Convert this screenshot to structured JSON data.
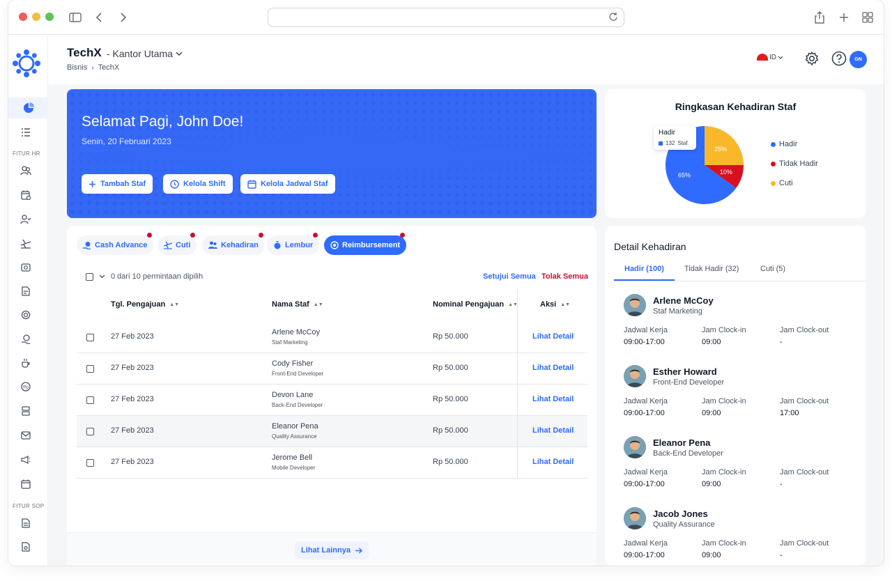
{
  "app": {
    "title": "TechX",
    "subtitle": "- Kantor Utama",
    "breadcrumb": [
      "Bisnis",
      "TechX"
    ],
    "language": "ID",
    "avatar_initials": "GN"
  },
  "sidebar": {
    "section_hr": "FITUR HR",
    "section_sop": "FITUR SOP"
  },
  "hero": {
    "greeting": "Selamat Pagi, John Doe!",
    "date": "Senin, 20 Februari 2023",
    "buttons": [
      {
        "label": "Tambah Staf",
        "icon": "plus-icon"
      },
      {
        "label": "Kelola Shift",
        "icon": "clock-icon"
      },
      {
        "label": "Kelola Jadwal Staf",
        "icon": "calendar-icon"
      }
    ]
  },
  "attendance_summary": {
    "title": "Ringkasan Kehadiran Staf",
    "tooltip": {
      "label": "Hadir",
      "value": "132",
      "unit": "Staf"
    },
    "chart_data": {
      "type": "pie",
      "slices": [
        {
          "name": "Hadir",
          "value": 65,
          "label": "65%",
          "color": "#2f6bff"
        },
        {
          "name": "Tidak Hadir",
          "value": 10,
          "label": "10%",
          "color": "#d90f1f"
        },
        {
          "name": "Cuti",
          "value": 25,
          "label": "25%",
          "color": "#f9b82c"
        }
      ],
      "legend": [
        "Hadir",
        "Tidak Hadir",
        "Cuti"
      ],
      "legend_position": "right"
    }
  },
  "requests": {
    "tabs": [
      {
        "label": "Cash Advance",
        "icon": "cash-advance-icon",
        "active": false
      },
      {
        "label": "Cuti",
        "icon": "plane-icon",
        "active": false
      },
      {
        "label": "Kehadiran",
        "icon": "users-icon",
        "active": false
      },
      {
        "label": "Lembur",
        "icon": "overtime-icon",
        "active": false
      },
      {
        "label": "Reimbursement",
        "icon": "reimbursement-icon",
        "active": true
      }
    ],
    "selection_text": "0 dari 10 permintaan dipilih",
    "approve_all": "Setujui Semua",
    "reject_all": "Tolak Semua",
    "columns": [
      "Tgl. Pengajuan",
      "Nama Staf",
      "Nominal Pengajuan",
      "Aksi"
    ],
    "rows": [
      {
        "date": "27 Feb 2023",
        "name": "Arlene McCoy",
        "role": "Staf Marketing",
        "amount": "Rp 50.000",
        "action": "Lihat Detail"
      },
      {
        "date": "27 Feb 2023",
        "name": "Cody Fisher",
        "role": "Front-End Developer",
        "amount": "Rp 50.000",
        "action": "Lihat Detail"
      },
      {
        "date": "27 Feb 2023",
        "name": "Devon Lane",
        "role": "Back-End Developer",
        "amount": "Rp 50.000",
        "action": "Lihat Detail"
      },
      {
        "date": "27 Feb 2023",
        "name": "Eleanor Pena",
        "role": "Quality Assurance",
        "amount": "Rp 50.000",
        "action": "Lihat Detail"
      },
      {
        "date": "27 Feb 2023",
        "name": "Jerome Bell",
        "role": "Mobile Developer",
        "amount": "Rp 50.000",
        "action": "Lihat Detail"
      }
    ],
    "more_label": "Lihat Lainnya"
  },
  "detail": {
    "title": "Detail Kehadiran",
    "tabs": [
      "Hadir (100)",
      "Tidak Hadir (32)",
      "Cuti (5)"
    ],
    "labels": {
      "schedule": "Jadwal Kerja",
      "clock_in": "Jam Clock-in",
      "clock_out": "Jam Clock-out"
    },
    "people": [
      {
        "name": "Arlene McCoy",
        "role": "Staf Marketing",
        "schedule": "09:00-17:00",
        "clock_in": "09:00",
        "clock_out": "-"
      },
      {
        "name": "Esther Howard",
        "role": "Front-End Developer",
        "schedule": "09:00-17:00",
        "clock_in": "09:00",
        "clock_out": "17:00"
      },
      {
        "name": "Eleanor Pena",
        "role": "Back-End Developer",
        "schedule": "09:00-17:00",
        "clock_in": "09:00",
        "clock_out": "-"
      },
      {
        "name": "Jacob Jones",
        "role": "Quality Assurance",
        "schedule": "09:00-17:00",
        "clock_in": "09:00",
        "clock_out": "-"
      }
    ]
  },
  "colors": {
    "accent": "#2f6bff",
    "danger": "#c8102e",
    "warning": "#f9b82c",
    "hero": "#3568f5"
  }
}
